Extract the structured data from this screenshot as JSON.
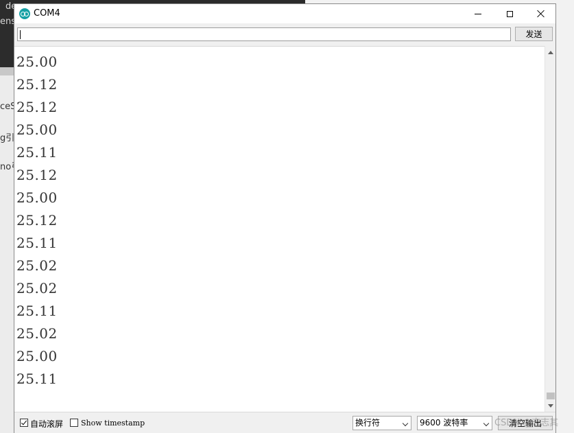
{
  "background_app": {
    "left_fragments": [
      "de",
      "ense",
      "ceS",
      "g引|",
      "no弓"
    ]
  },
  "window": {
    "title": "COM4",
    "icon": "arduino-icon",
    "controls": {
      "minimize_icon": "minimize-icon",
      "maximize_icon": "maximize-icon",
      "close_icon": "close-icon"
    }
  },
  "send_bar": {
    "input_value": "",
    "send_label": "发送"
  },
  "output": {
    "lines": [
      "25.00",
      "25.12",
      "25.12",
      "25.00",
      "25.11",
      "25.12",
      "25.00",
      "25.12",
      "25.11",
      "25.02",
      "25.02",
      "25.11",
      "25.02",
      "25.00",
      "25.11"
    ]
  },
  "bottom_bar": {
    "autoscroll_label": "自动滚屏",
    "autoscroll_checked": true,
    "timestamp_label": "Show timestamp",
    "timestamp_checked": false,
    "line_ending": "换行符",
    "baud_rate": "9600 波特率",
    "clear_label": "清空输出"
  },
  "watermark": "CSDN @志志其"
}
